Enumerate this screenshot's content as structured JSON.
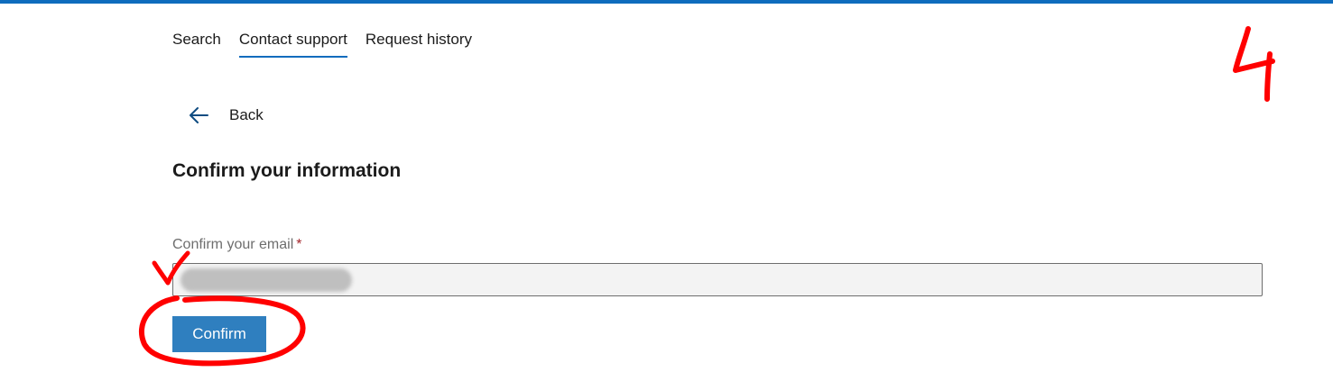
{
  "nav": {
    "tabs": [
      {
        "label": "Search"
      },
      {
        "label": "Contact support"
      },
      {
        "label": "Request history"
      }
    ]
  },
  "back": {
    "label": "Back"
  },
  "form": {
    "title": "Confirm your information",
    "email_label": "Confirm your email",
    "required_marker": "*",
    "email_value": "",
    "confirm_label": "Confirm"
  },
  "annotation": {
    "step_number": "4",
    "color": "#ff0000"
  },
  "colors": {
    "accent": "#0f6cbd",
    "button": "#2f7fbf",
    "required": "#a4262c"
  },
  "icons": {
    "back": "arrow-left-icon"
  }
}
